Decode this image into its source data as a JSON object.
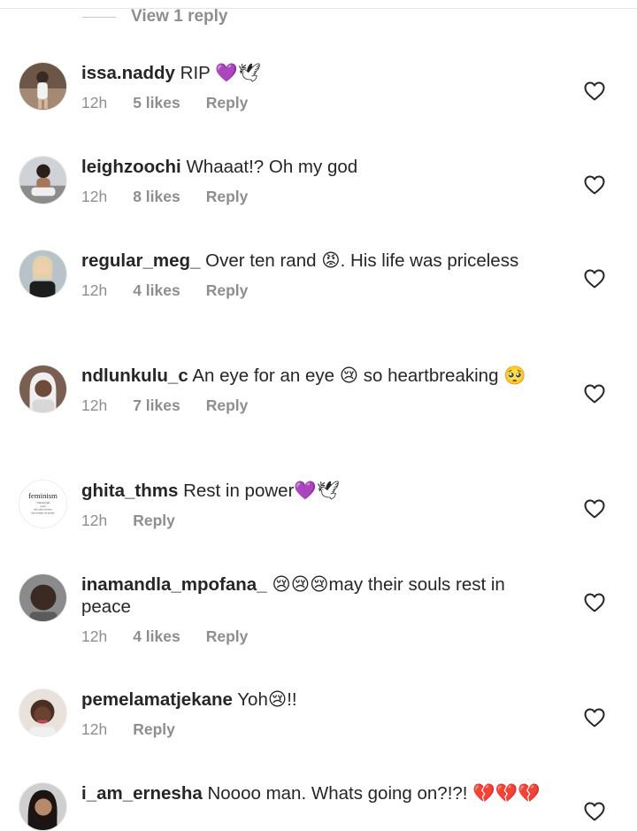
{
  "view_replies": "View 1 reply",
  "comments": [
    {
      "username": "issa.naddy",
      "text": "RIP 💜🕊",
      "time": "12h",
      "likes": "5 likes",
      "reply": "Reply"
    },
    {
      "username": "leighzoochi",
      "text": "Whaaat!? Oh my god",
      "time": "12h",
      "likes": "8 likes",
      "reply": "Reply"
    },
    {
      "username": "regular_meg_",
      "text": "Over ten rand 😡. His life was priceless",
      "time": "12h",
      "likes": "4 likes",
      "reply": "Reply"
    },
    {
      "username": "ndlunkulu_c",
      "text": "An eye for an eye 😢 so heartbreaking 🥺",
      "time": "12h",
      "likes": "7 likes",
      "reply": "Reply"
    },
    {
      "username": "ghita_thms",
      "text": "Rest in power💜🕊",
      "time": "12h",
      "reply": "Reply",
      "avatar_text": [
        "feminism",
        "/ˈfɛmɪnɪz(ə)m/",
        "noun",
        "the radical notion",
        "that women are people"
      ]
    },
    {
      "username": "inamandla_mpofana_",
      "text": "😢😢😢may their souls rest in peace",
      "time": "12h",
      "likes": "4 likes",
      "reply": "Reply"
    },
    {
      "username": "pemelamatjekane",
      "text": "Yoh😢!!",
      "time": "12h",
      "reply": "Reply"
    },
    {
      "username": "i_am_ernesha",
      "text": "Noooo man. Whats going on?!?! 💔💔💔",
      "time": "",
      "reply": ""
    }
  ],
  "colors": {
    "text": "#262626",
    "secondary": "#8e8e8e",
    "accent_heart": "#262626"
  },
  "icons": {
    "like": "heart-outline-icon"
  }
}
